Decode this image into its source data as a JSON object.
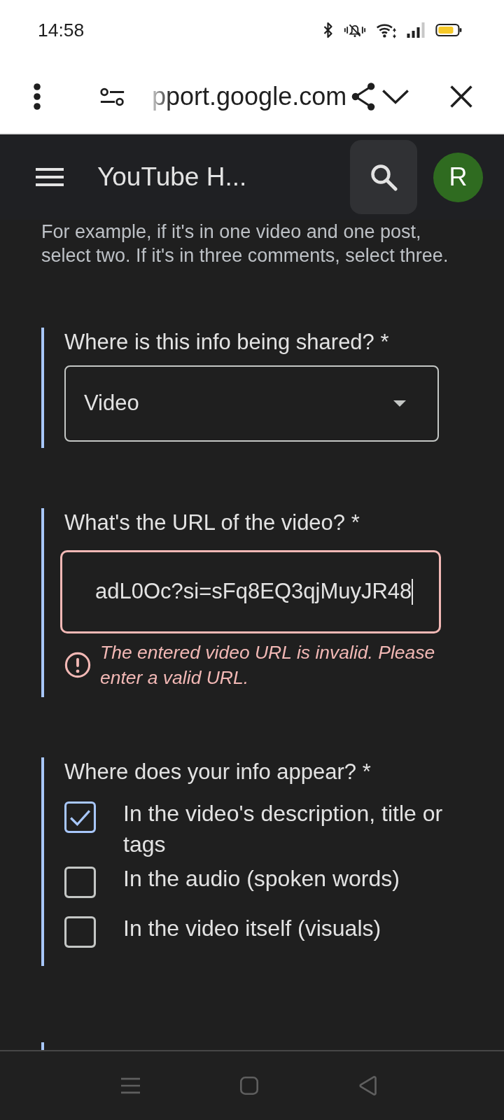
{
  "status_bar": {
    "time": "14:58"
  },
  "browser_bar": {
    "url": "pport.google.com"
  },
  "header": {
    "title": "YouTube H...",
    "avatar_letter": "R"
  },
  "intro": "For example, if it's in one video and one post, select two. If it's in three comments, select three.",
  "questions": [
    {
      "kind": "select",
      "label": "Where is this info being shared? *",
      "value": "Video"
    },
    {
      "kind": "text",
      "label": "What's the URL of the video? *",
      "value": "adL0Oc?si=sFq8EQ3qjMuyJR48",
      "invalid": true,
      "error": "The entered video URL is invalid. Please enter a valid URL."
    },
    {
      "kind": "checkboxes",
      "label": "Where does your info appear? *",
      "options": [
        {
          "label": "In the video's description, title or tags",
          "checked": true
        },
        {
          "label": "In the audio (spoken words)",
          "checked": false
        },
        {
          "label": "In the video itself (visuals)",
          "checked": false
        }
      ]
    },
    {
      "kind": "cut_off"
    }
  ]
}
